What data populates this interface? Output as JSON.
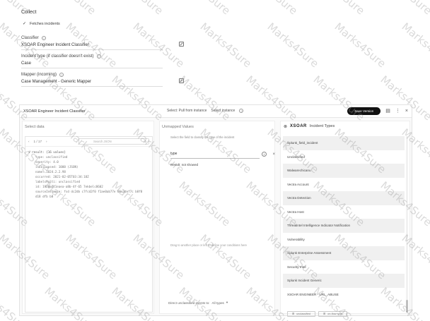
{
  "section": {
    "title": "Collect",
    "fetch_incidents_label": "Fetches incidents",
    "classifier_label": "Classifier",
    "classifier_value": "XSOAR Engineer Incident Classifier",
    "incident_type_label": "Incident type (if classifier doesn't exist)",
    "incident_type_value": "Case",
    "mapper_label": "Mapper (incoming)",
    "mapper_value": "Case Management - Generic Mapper"
  },
  "dialog": {
    "title": "XSOAR Engineer Incident Classifier",
    "select_label": "Select: Pull from instance",
    "select_instance": "Select instance",
    "save_button": "Save Version",
    "left_title": "Select data",
    "sample_count": "1 / 17",
    "search_placeholder": "Search JSON",
    "json_lines": [
      "▾ result: {16 values}",
      "type: unclassified",
      "severity: 4.0",
      "isCollapsed: 1000 (JSON)",
      "name: 1024.2.2.98",
      "occurred: 2021-02-05T03:34:18Z",
      "labelsMulti: unclassified",
      "id: 1920e2c1eaea-a8b-4f-65 7ekbelc8602",
      "sourceInstance: fsd  dc2db c7fcd2f0  f1ae0ab77e 06c3def7c  b8f8 d18 dfb b8"
    ],
    "mid_help": "Select the field to classify the type of the incident",
    "mid_input": "type",
    "mid_result": "Result: not showed",
    "mid_empty": "Drag to another place or left to define your conditions here",
    "mid_footer": "Direct unclassified events to:",
    "mid_footer_value": "All types",
    "right_brand": "XSOAR",
    "right_title": "Incident Types",
    "incident_types": [
      "Splunk_field_incident",
      "Unclassified",
      "Walwarechicanu",
      "Vectra Account",
      "Vectra Detection",
      "Vectra Host",
      "Threatintel Intelligence Indicator Notification",
      "Vulnerability",
      "Splunk Enterprise Assessment",
      "Security Intel",
      "Splunk Incident Generic",
      "XSOAR ENGINEER - URL_ABUSE"
    ],
    "pill_left": "unclassified",
    "pill_right": "on-flow type"
  },
  "watermark": "Marks4Sure"
}
